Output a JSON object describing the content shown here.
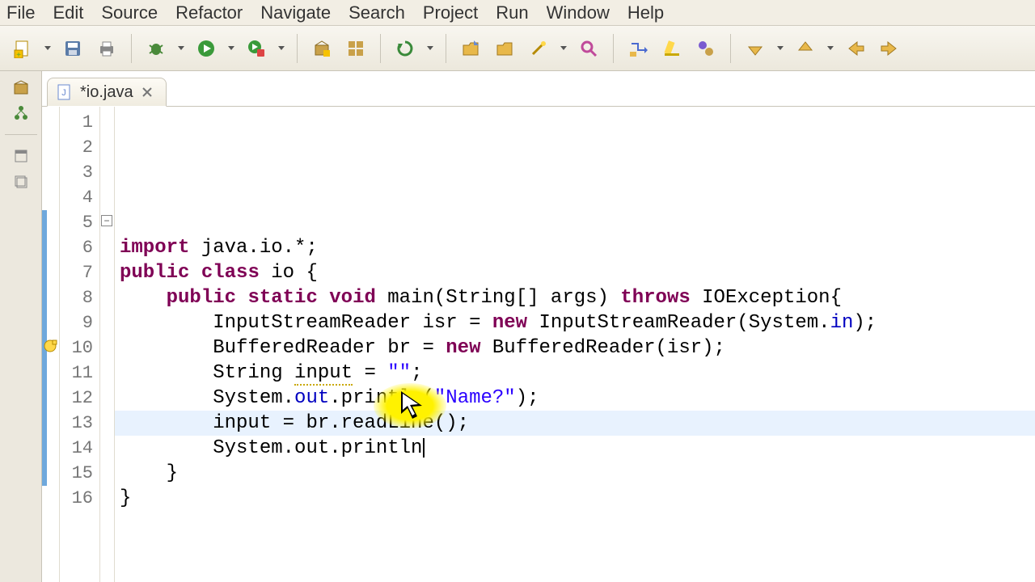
{
  "menu": {
    "items": [
      "File",
      "Edit",
      "Source",
      "Refactor",
      "Navigate",
      "Search",
      "Project",
      "Run",
      "Window",
      "Help"
    ]
  },
  "toolbar": {
    "icons": [
      "new-icon",
      "dd",
      "save-icon",
      "print-icon",
      "sep",
      "debug-icon",
      "dd",
      "run-icon",
      "dd",
      "run-last-icon",
      "dd",
      "sep",
      "new-package-icon",
      "open-type-icon",
      "sep",
      "refresh-icon",
      "dd",
      "sep",
      "open-folder-icon",
      "folder-icon",
      "wand-icon",
      "dd",
      "search-icon",
      "sep",
      "step-icon",
      "highlight-icon",
      "breakpoint-icon",
      "sep",
      "nav-down-icon",
      "dd",
      "nav-up-icon",
      "dd",
      "back-icon",
      "forward-icon"
    ]
  },
  "leftgutter": {
    "icons": [
      "package-icon",
      "hierarchy-icon",
      "div",
      "minimize-icon",
      "restore-icon"
    ]
  },
  "tab": {
    "filename": "*io.java"
  },
  "code": {
    "lines": [
      {
        "n": 1,
        "t": [
          [
            "kw",
            "import"
          ],
          [
            "",
            " java.io.*;"
          ]
        ]
      },
      {
        "n": 2,
        "t": [
          [
            "",
            ""
          ]
        ]
      },
      {
        "n": 3,
        "t": [
          [
            "kw",
            "public"
          ],
          [
            "",
            " "
          ],
          [
            "kw",
            "class"
          ],
          [
            "",
            " io {"
          ]
        ]
      },
      {
        "n": 4,
        "t": [
          [
            "",
            ""
          ]
        ]
      },
      {
        "n": 5,
        "t": [
          [
            "",
            "    "
          ],
          [
            "kw",
            "public"
          ],
          [
            "",
            " "
          ],
          [
            "kw",
            "static"
          ],
          [
            "",
            " "
          ],
          [
            "kw",
            "void"
          ],
          [
            "",
            " main(String[] args) "
          ],
          [
            "kw",
            "throws"
          ],
          [
            "",
            " IOException{"
          ]
        ],
        "fold": true
      },
      {
        "n": 6,
        "t": [
          [
            "",
            ""
          ]
        ]
      },
      {
        "n": 7,
        "t": [
          [
            "",
            "        InputStreamReader isr = "
          ],
          [
            "kw",
            "new"
          ],
          [
            "",
            " InputStreamReader(System."
          ],
          [
            "fld",
            "in"
          ],
          [
            "",
            ");"
          ]
        ]
      },
      {
        "n": 8,
        "t": [
          [
            "",
            "        BufferedReader br = "
          ],
          [
            "kw",
            "new"
          ],
          [
            "",
            " BufferedReader(isr);"
          ]
        ]
      },
      {
        "n": 9,
        "t": [
          [
            "",
            ""
          ]
        ]
      },
      {
        "n": 10,
        "t": [
          [
            "",
            "        String "
          ],
          [
            "warn",
            "input"
          ],
          [
            "",
            " = "
          ],
          [
            "str",
            "\"\""
          ],
          [
            "",
            ";"
          ]
        ],
        "warn": true
      },
      {
        "n": 11,
        "t": [
          [
            "",
            "        System."
          ],
          [
            "fld",
            "out"
          ],
          [
            "",
            ".println("
          ],
          [
            "str",
            "\"Name?\""
          ],
          [
            "",
            ");"
          ]
        ]
      },
      {
        "n": 12,
        "t": [
          [
            "",
            "        input = br.readLine();"
          ]
        ]
      },
      {
        "n": 13,
        "t": [
          [
            "",
            "        System.out.println"
          ]
        ],
        "current": true,
        "caret": true
      },
      {
        "n": 14,
        "t": [
          [
            "",
            "    }"
          ]
        ]
      },
      {
        "n": 15,
        "t": [
          [
            "",
            "}"
          ]
        ]
      },
      {
        "n": 16,
        "t": [
          [
            "",
            ""
          ]
        ]
      }
    ],
    "changed_from": 5,
    "changed_to": 15
  },
  "colors": {
    "keyword": "#7f0055",
    "string": "#2a00ff",
    "field": "#0000c0"
  }
}
